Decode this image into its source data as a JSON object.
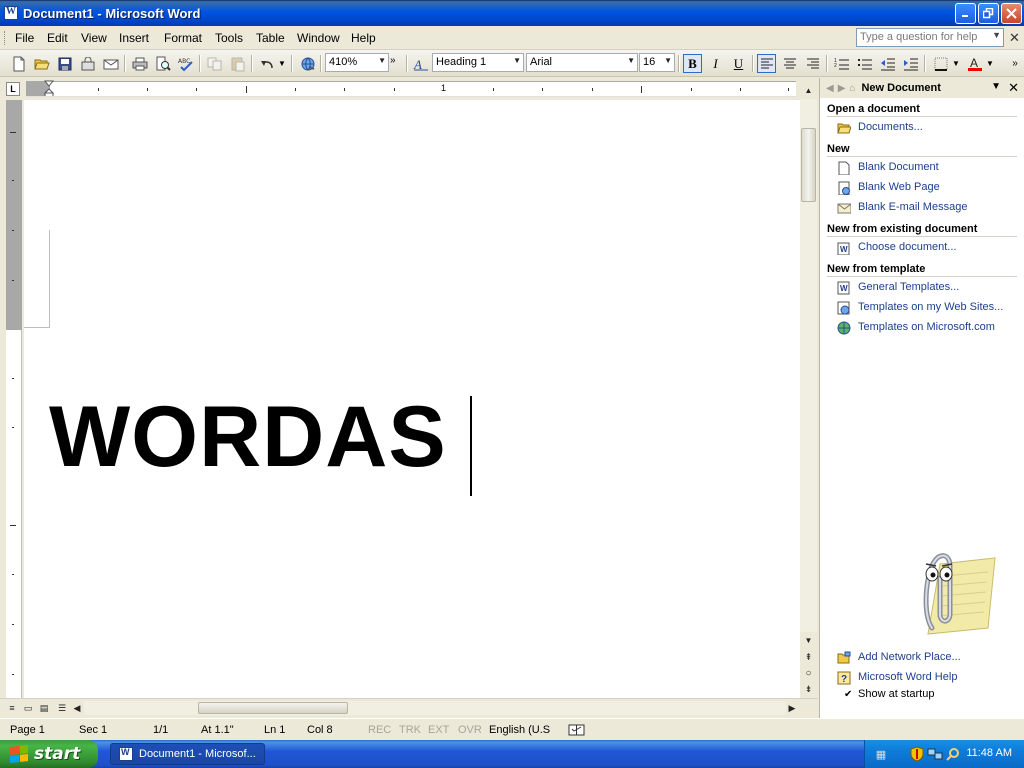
{
  "window": {
    "title": "Document1 - Microsoft Word"
  },
  "menu": {
    "items": [
      "File",
      "Edit",
      "View",
      "Insert",
      "Format",
      "Tools",
      "Table",
      "Window",
      "Help"
    ],
    "help_placeholder": "Type a question for help"
  },
  "toolbar": {
    "zoom": "410%",
    "style": "Heading 1",
    "font": "Arial",
    "size": "16",
    "bold": "B",
    "italic": "I",
    "underline": "U"
  },
  "ruler": {
    "tab_selector": "L",
    "label_1": "1"
  },
  "document": {
    "text": "WORDAS"
  },
  "task_pane": {
    "title": "New Document",
    "sections": {
      "open": "Open a document",
      "new": "New",
      "existing": "New from existing document",
      "template": "New from template"
    },
    "links": {
      "documents": "Documents...",
      "blank_document": "Blank Document",
      "blank_web_page": "Blank Web Page",
      "blank_email": "Blank E-mail Message",
      "choose_document": "Choose document...",
      "general_templates": "General Templates...",
      "templates_web_sites": "Templates on my Web Sites...",
      "templates_microsoft": "Templates on Microsoft.com",
      "add_network_place": "Add Network Place...",
      "word_help": "Microsoft Word Help"
    },
    "show_at_startup": "Show at startup",
    "show_at_startup_checked": true
  },
  "status": {
    "page": "Page 1",
    "sec": "Sec 1",
    "pages": "1/1",
    "at": "At 1.1\"",
    "ln": "Ln 1",
    "col": "Col 8",
    "rec": "REC",
    "trk": "TRK",
    "ext": "EXT",
    "ovr": "OVR",
    "language": "English (U.S"
  },
  "taskbar": {
    "start_label": "start",
    "task_item": "Document1 - Microsof...",
    "clock": "11:48 AM"
  },
  "colors": {
    "titlebar": "#0054e3",
    "link": "#1e3f8d",
    "taskbar": "#2157d7",
    "start_button": "#3c9a3c"
  }
}
